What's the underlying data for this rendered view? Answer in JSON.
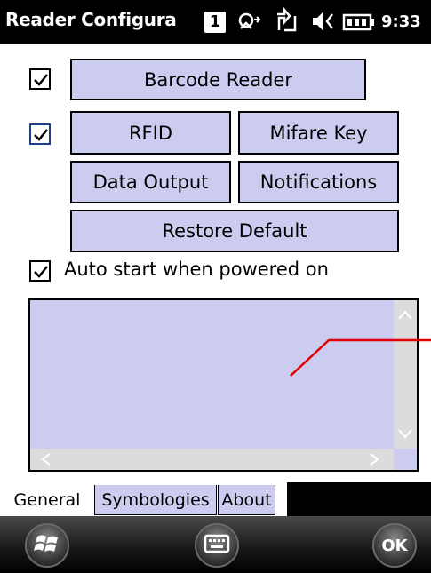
{
  "titlebar": {
    "title": "Reader Configura",
    "badge": "1",
    "clock": "9:33",
    "icons": [
      "network-icon",
      "sync-icon",
      "volume-icon",
      "battery-icon"
    ]
  },
  "buttons": {
    "barcode_reader": "Barcode Reader",
    "rfid": "RFID",
    "mifare_key": "Mifare Key",
    "data_output": "Data Output",
    "notifications": "Notifications",
    "restore_default": "Restore Default"
  },
  "checkboxes": {
    "barcode_checked": true,
    "rfid_checked": true,
    "auto_start_checked": true,
    "auto_start_label": "Auto start when powered on"
  },
  "tabs": [
    {
      "label": "General",
      "active": true
    },
    {
      "label": "Symbologies",
      "active": false
    },
    {
      "label": "About",
      "active": false
    }
  ],
  "softkeys": {
    "left_icon": "windows-start-icon",
    "center_icon": "keyboard-icon",
    "right_label": "OK"
  },
  "colors": {
    "button_fill": "#ccccf0",
    "annotation_line": "#e00000"
  }
}
